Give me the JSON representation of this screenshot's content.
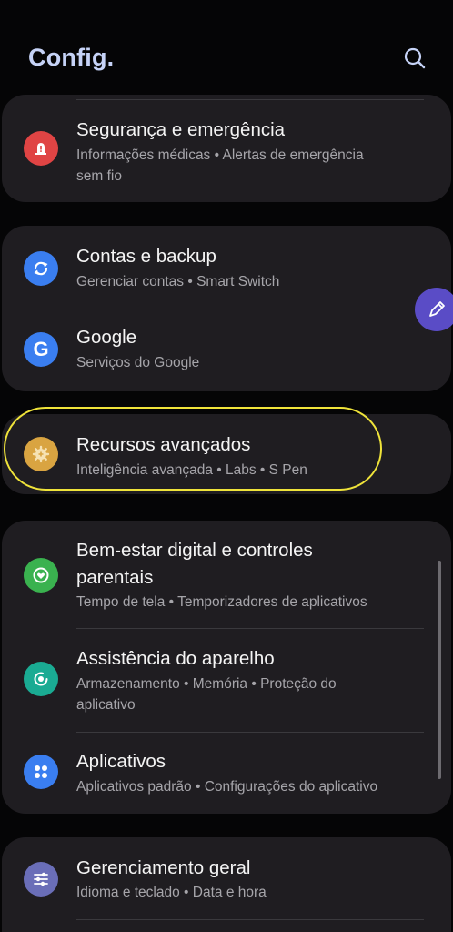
{
  "header": {
    "title": "Config."
  },
  "icons": {
    "search": "search-icon",
    "edit": "pen-icon"
  },
  "colors": {
    "background": "#050506",
    "card": "#1f1d21",
    "title_accent": "#c6d3f7",
    "highlight": "#efe33a",
    "security_icon": "#e04444",
    "accounts_icon": "#3a7ef0",
    "google_icon": "#3a7ef0",
    "advanced_icon": "#d9a441",
    "wellbeing_icon": "#3ab24f",
    "care_icon": "#1aab93",
    "apps_icon": "#3a7ef0",
    "general_icon": "#6a6eb8"
  },
  "items": {
    "security": {
      "title": "Segurança e emergência",
      "sub1": "Informações médicas  •  Alertas de emergência",
      "sub2": "sem fio"
    },
    "accounts": {
      "title": "Contas e backup",
      "sub1": "Gerenciar contas  •  Smart Switch"
    },
    "google": {
      "title": "Google",
      "sub1": "Serviços do Google"
    },
    "advanced": {
      "title": "Recursos avançados",
      "sub1": "Inteligência avançada  •  Labs  •  S Pen"
    },
    "wellbeing": {
      "title1": "Bem-estar digital e controles",
      "title2": "parentais",
      "sub1": "Tempo de tela  •  Temporizadores de aplicativos"
    },
    "care": {
      "title": "Assistência do aparelho",
      "sub1": "Armazenamento  •  Memória  •  Proteção do",
      "sub2": "aplicativo"
    },
    "apps": {
      "title": "Aplicativos",
      "sub1": "Aplicativos padrão  •  Configurações do aplicativo"
    },
    "general": {
      "title": "Gerenciamento geral",
      "sub1": "Idioma e teclado  •  Data e hora"
    }
  }
}
